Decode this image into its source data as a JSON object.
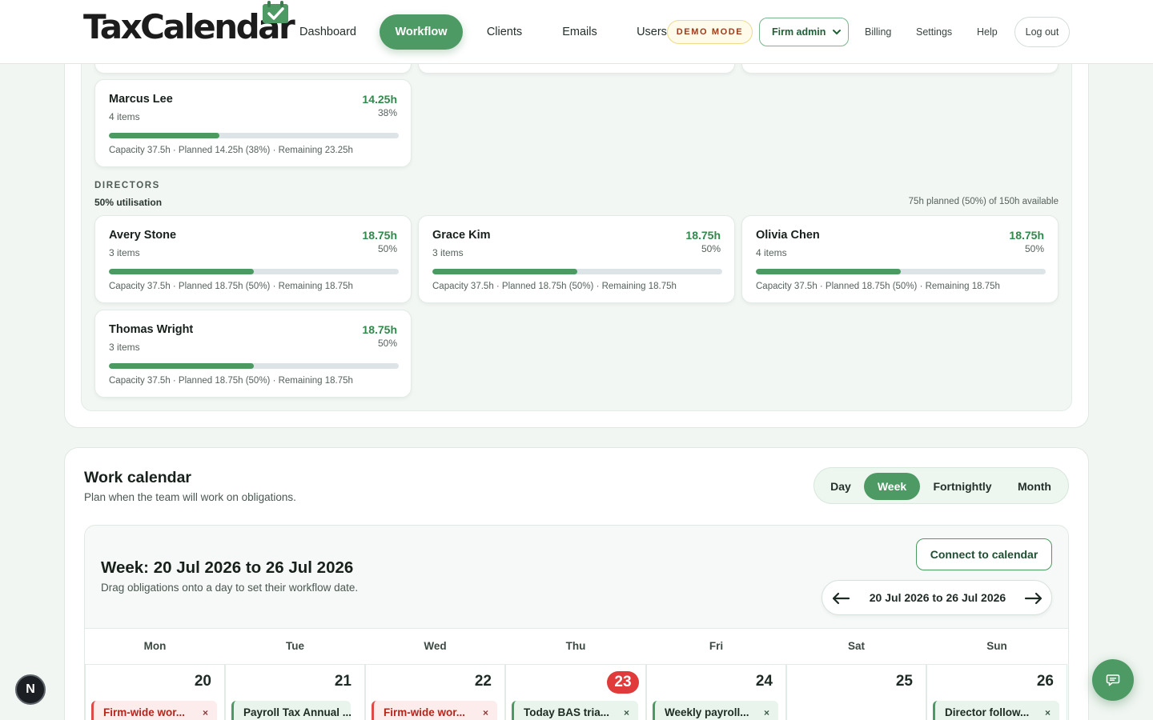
{
  "header": {
    "logo_text": "TaxCalendar",
    "nav": [
      {
        "label": "Dashboard",
        "active": false
      },
      {
        "label": "Workflow",
        "active": true
      },
      {
        "label": "Clients",
        "active": false
      },
      {
        "label": "Emails",
        "active": false
      },
      {
        "label": "Users",
        "active": false
      }
    ],
    "demo_badge": "DEMO MODE",
    "role_select": "Firm admin",
    "links": [
      "Billing",
      "Settings",
      "Help"
    ],
    "logout": "Log out"
  },
  "capacity": {
    "marcus": {
      "name": "Marcus Lee",
      "items": "4 items",
      "hours": "14.25h",
      "pct": "38%",
      "fill": 0.38,
      "summary": "Capacity 37.5h · Planned 14.25h (38%) · Remaining 23.25h"
    },
    "directors": {
      "title": "DIRECTORS",
      "utilisation": "50% utilisation",
      "summary": "75h planned (50%) of 150h available",
      "members": [
        {
          "name": "Avery Stone",
          "items": "3 items",
          "hours": "18.75h",
          "pct": "50%",
          "fill": 0.5,
          "summary": "Capacity 37.5h · Planned 18.75h (50%) · Remaining 18.75h"
        },
        {
          "name": "Grace Kim",
          "items": "3 items",
          "hours": "18.75h",
          "pct": "50%",
          "fill": 0.5,
          "summary": "Capacity 37.5h · Planned 18.75h (50%) · Remaining 18.75h"
        },
        {
          "name": "Olivia Chen",
          "items": "4 items",
          "hours": "18.75h",
          "pct": "50%",
          "fill": 0.5,
          "summary": "Capacity 37.5h · Planned 18.75h (50%) · Remaining 18.75h"
        },
        {
          "name": "Thomas Wright",
          "items": "3 items",
          "hours": "18.75h",
          "pct": "50%",
          "fill": 0.5,
          "summary": "Capacity 37.5h · Planned 18.75h (50%) · Remaining 18.75h"
        }
      ]
    }
  },
  "calendar": {
    "title": "Work calendar",
    "subtitle": "Plan when the team will work on obligations.",
    "views": [
      {
        "label": "Day",
        "active": false
      },
      {
        "label": "Week",
        "active": true
      },
      {
        "label": "Fortnightly",
        "active": false
      },
      {
        "label": "Month",
        "active": false
      }
    ],
    "week_title": "Week: 20 Jul 2026 to 26 Jul 2026",
    "week_hint": "Drag obligations onto a day to set their workflow date.",
    "connect_label": "Connect to calendar",
    "range_label": "20 Jul 2026 to 26 Jul 2026",
    "days": [
      {
        "name": "Mon",
        "num": "20",
        "today": false,
        "event": {
          "label": "Firm-wide wor...",
          "color": "red"
        }
      },
      {
        "name": "Tue",
        "num": "21",
        "today": false,
        "event": {
          "label": "Payroll Tax Annual ...",
          "color": "green"
        }
      },
      {
        "name": "Wed",
        "num": "22",
        "today": false,
        "event": {
          "label": "Firm-wide wor...",
          "color": "red"
        }
      },
      {
        "name": "Thu",
        "num": "23",
        "today": true,
        "event": {
          "label": "Today BAS tria...",
          "color": "green"
        }
      },
      {
        "name": "Fri",
        "num": "24",
        "today": false,
        "event": {
          "label": "Weekly payroll...",
          "color": "green"
        }
      },
      {
        "name": "Sat",
        "num": "25",
        "today": false,
        "event": null
      },
      {
        "name": "Sun",
        "num": "26",
        "today": false,
        "event": {
          "label": "Director follow...",
          "color": "green"
        }
      }
    ],
    "event_close": "×"
  },
  "floating": {
    "dev_badge": "N",
    "chat_icon": "chat-icon"
  },
  "colors": {
    "accent": "#4d9a64",
    "today": "#e03a3a",
    "event_red": "#dd4a4a",
    "event_green": "#4b9a61"
  }
}
